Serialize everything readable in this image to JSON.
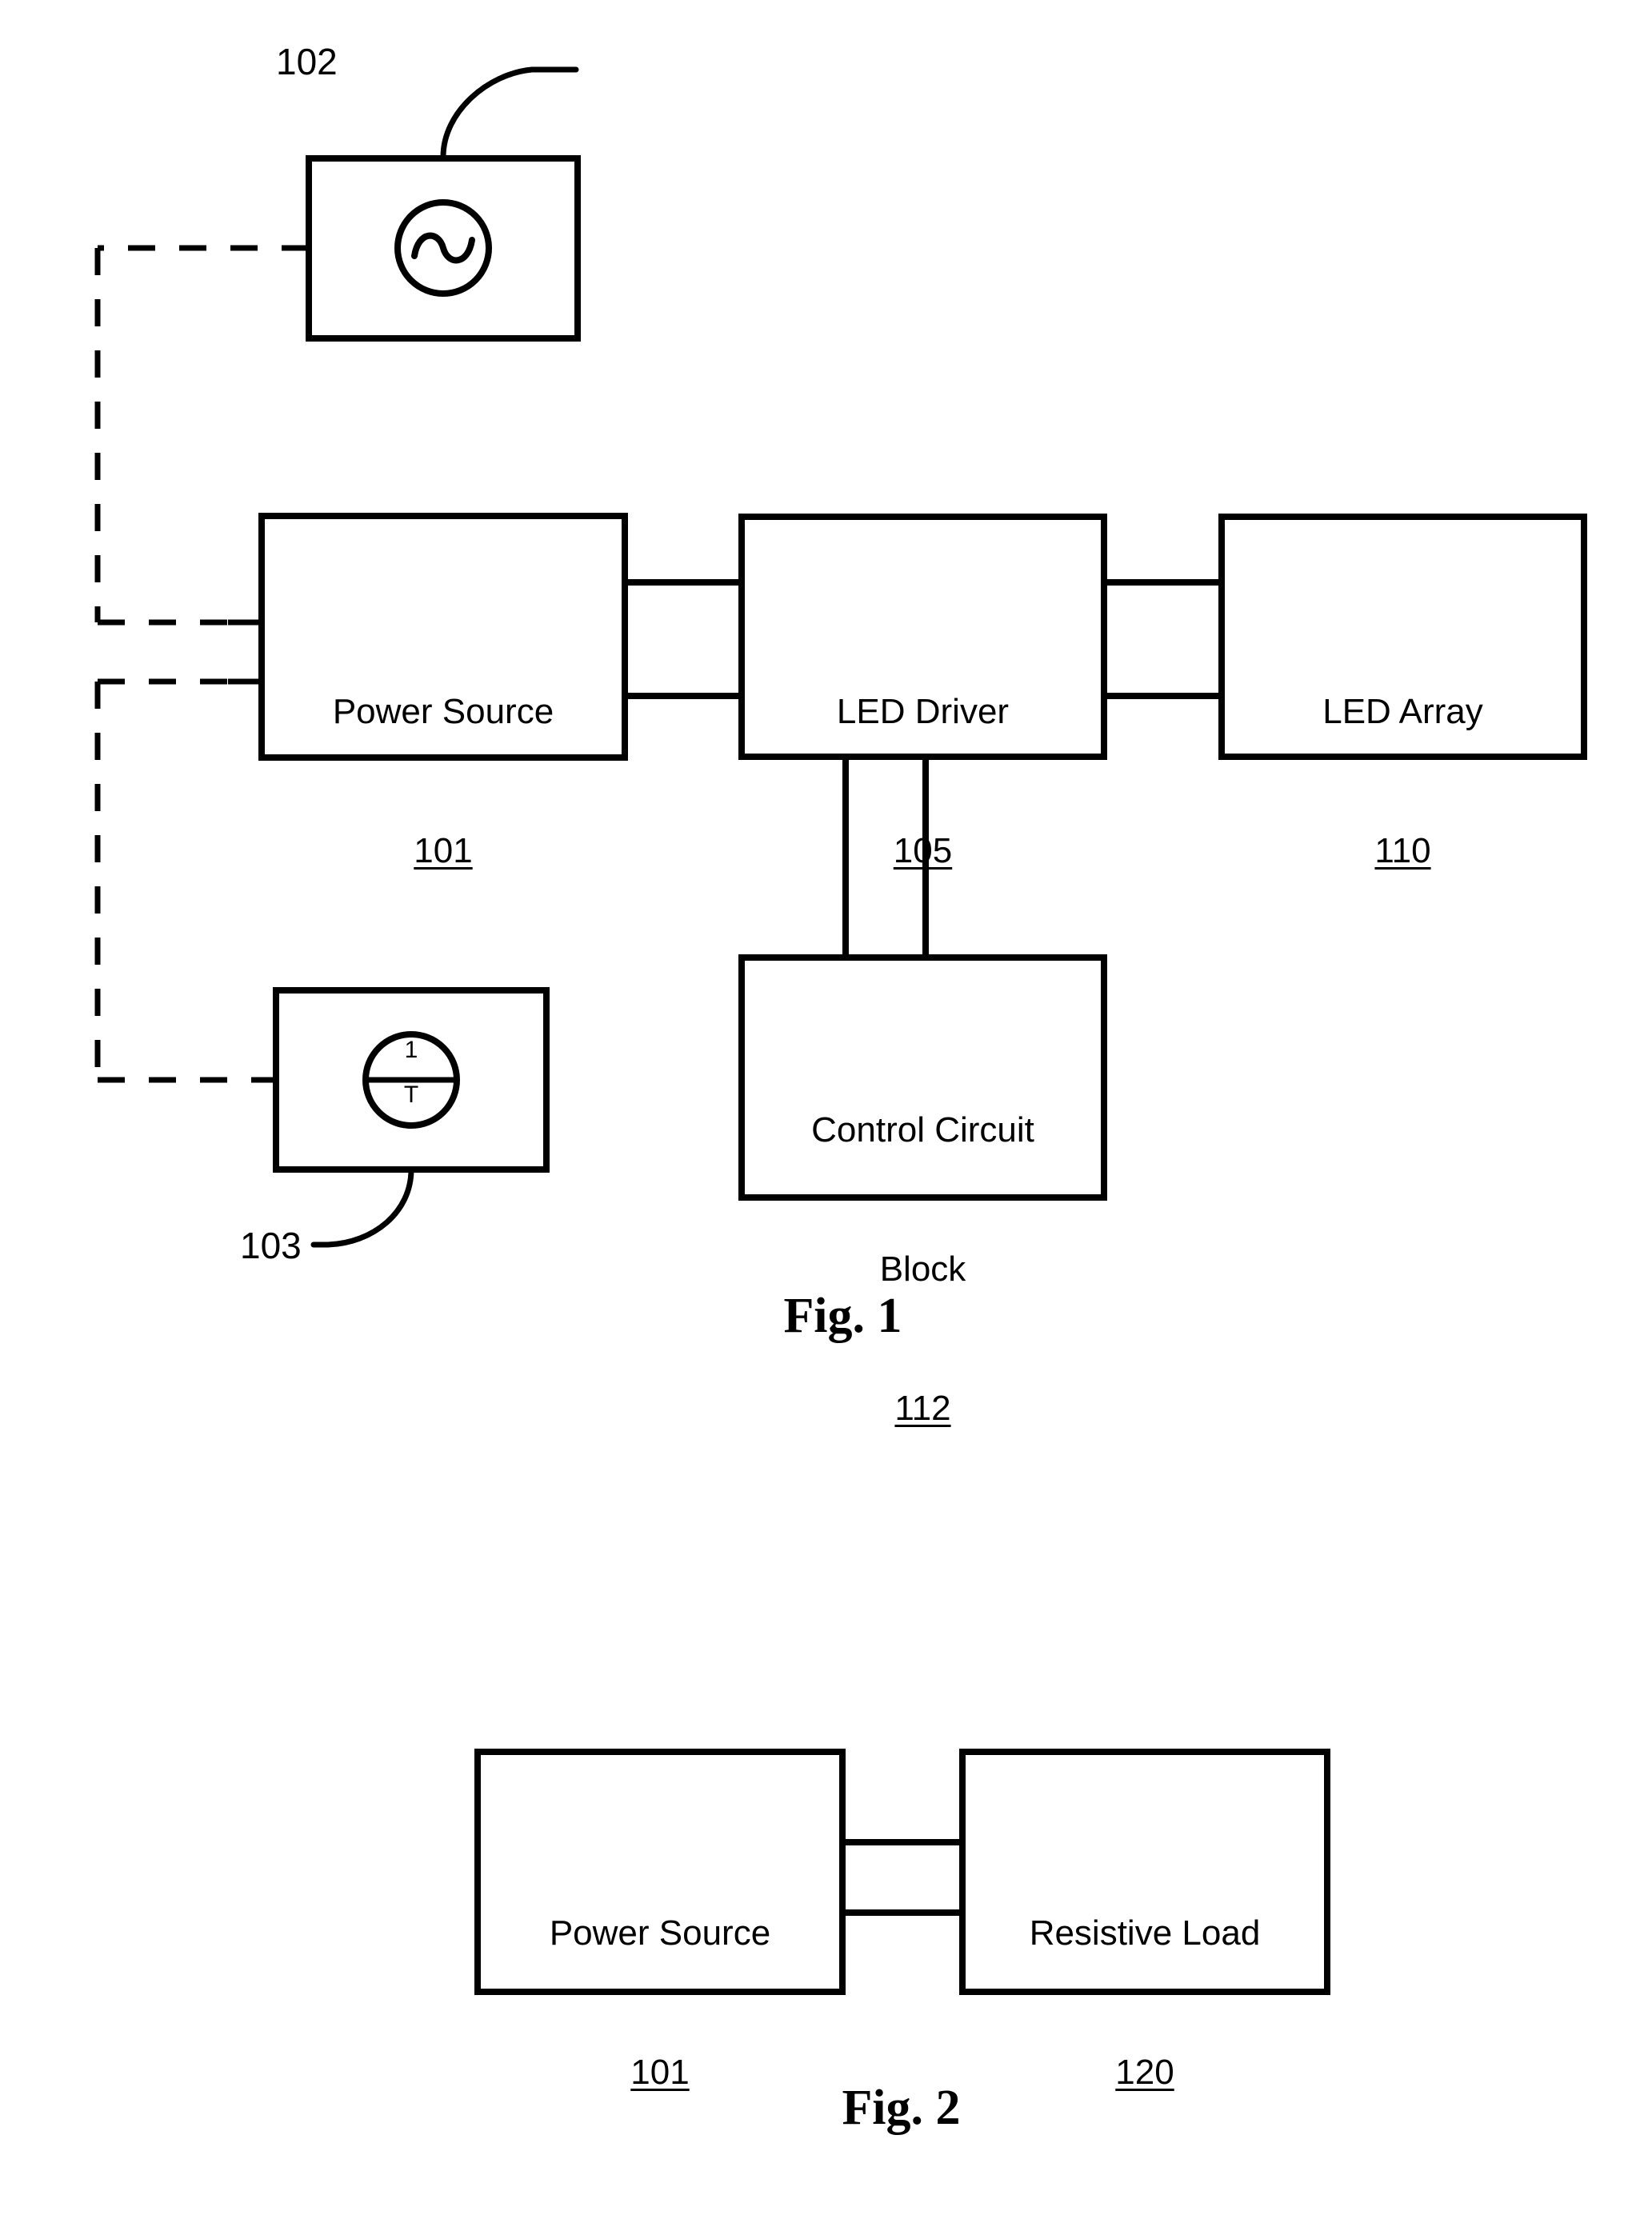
{
  "document": {
    "type": "patent-figure-sheet",
    "background": "#ffffff",
    "line_color": "#000000"
  },
  "figure1": {
    "caption": "Fig. 1",
    "ac_source_box": {
      "symbol": "ac-sine-source-icon",
      "ref_label": "102"
    },
    "frequency_box": {
      "symbol": "one-over-T-icon",
      "numerator": "1",
      "denominator": "T",
      "ref_label": "103"
    },
    "blocks": [
      {
        "name": "power-source",
        "title": "Power Source",
        "number": "101"
      },
      {
        "name": "led-driver",
        "title": "LED Driver",
        "number": "105"
      },
      {
        "name": "led-array",
        "title": "LED Array",
        "number": "110"
      },
      {
        "name": "control-circuit-block",
        "title_line1": "Control Circuit",
        "title_line2": "Block",
        "number": "112"
      }
    ]
  },
  "figure2": {
    "caption": "Fig. 2",
    "blocks": [
      {
        "name": "power-source",
        "title": "Power Source",
        "number": "101"
      },
      {
        "name": "resistive-load",
        "title": "Resistive Load",
        "number": "120"
      }
    ]
  }
}
